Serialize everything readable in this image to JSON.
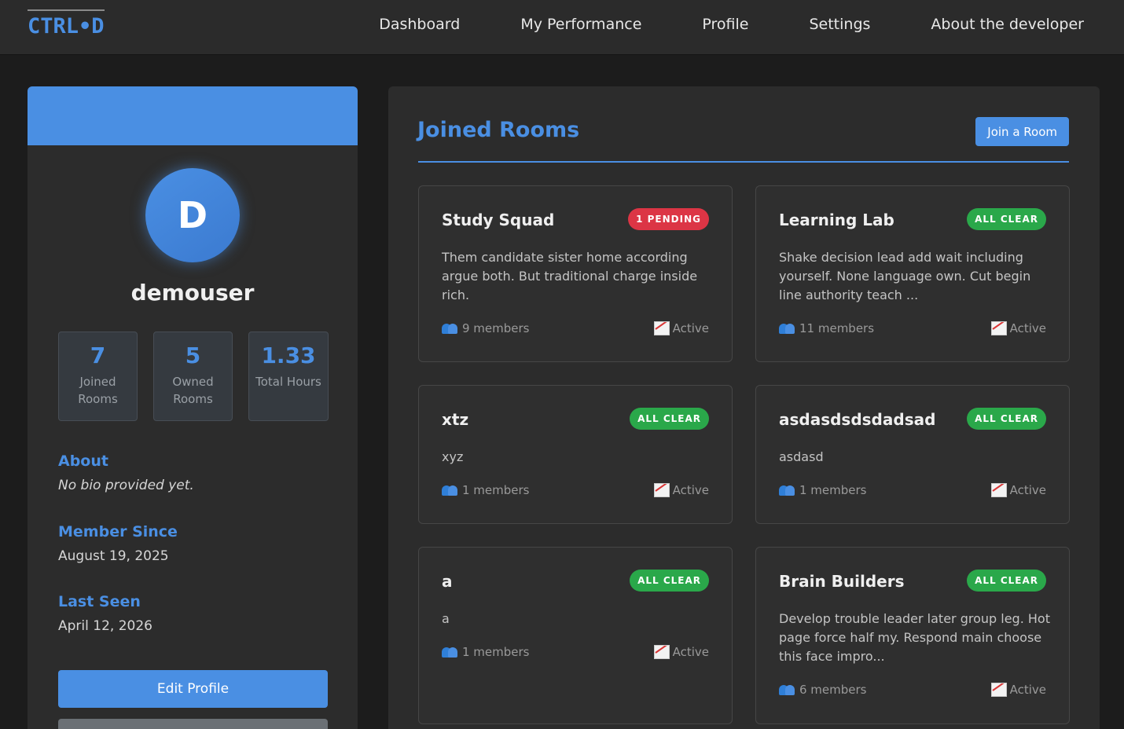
{
  "nav": {
    "brand": "CTRL•D",
    "links": [
      "Dashboard",
      "My Performance",
      "Profile",
      "Settings",
      "About the developer"
    ]
  },
  "profile": {
    "avatar_letter": "D",
    "username": "demouser",
    "stats": [
      {
        "value": "7",
        "label": "Joined Rooms"
      },
      {
        "value": "5",
        "label": "Owned Rooms"
      },
      {
        "value": "1.33",
        "label": "Total Hours"
      }
    ],
    "about_title": "About",
    "about_text": "No bio provided yet.",
    "member_since_title": "Member Since",
    "member_since": "August 19, 2025",
    "last_seen_title": "Last Seen",
    "last_seen": "April 12, 2026",
    "edit_label": "Edit Profile"
  },
  "rooms": {
    "title": "Joined Rooms",
    "join_label": "Join a Room",
    "items": [
      {
        "name": "Study Squad",
        "badge": "1 PENDING",
        "badge_color": "#dc3545",
        "desc": "Them candidate sister home according argue both. But traditional charge inside rich.",
        "members": "9 members",
        "status": "Active"
      },
      {
        "name": "Learning Lab",
        "badge": "ALL CLEAR",
        "badge_color": "#2aa84a",
        "desc": "Shake decision lead add wait including yourself. None language own. Cut begin line authority teach ...",
        "members": "11 members",
        "status": "Active"
      },
      {
        "name": "xtz",
        "badge": "ALL CLEAR",
        "badge_color": "#2aa84a",
        "desc": "xyz",
        "members": "1 members",
        "status": "Active"
      },
      {
        "name": "asdasdsdsdadsad",
        "badge": "ALL CLEAR",
        "badge_color": "#2aa84a",
        "desc": "asdasd",
        "members": "1 members",
        "status": "Active"
      },
      {
        "name": "a",
        "badge": "ALL CLEAR",
        "badge_color": "#2aa84a",
        "desc": "a",
        "members": "1 members",
        "status": "Active"
      },
      {
        "name": "Brain Builders",
        "badge": "ALL CLEAR",
        "badge_color": "#2aa84a",
        "desc": "Develop trouble leader later group leg. Hot page force half my. Respond main choose this face impro...",
        "members": "6 members",
        "status": "Active"
      }
    ]
  },
  "icons": {
    "members": "members-icon",
    "activity": "chart-increasing-icon"
  }
}
